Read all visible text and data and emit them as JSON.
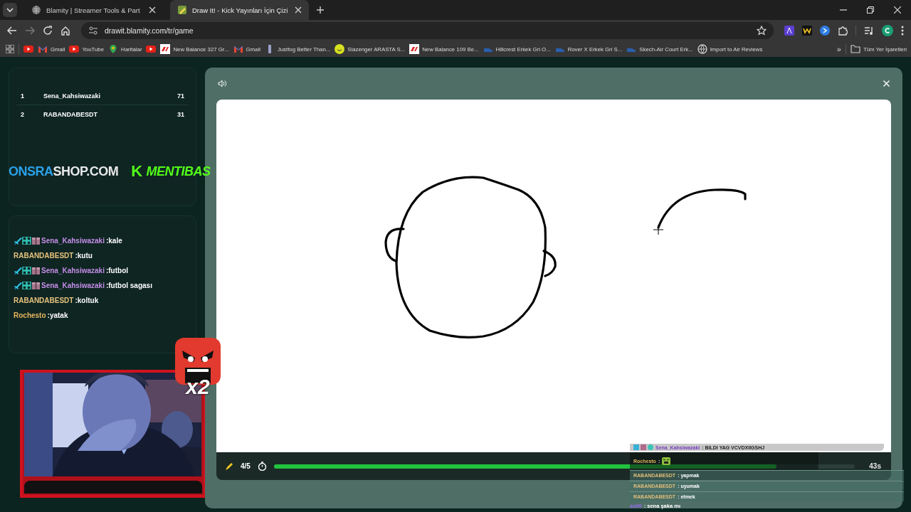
{
  "browser": {
    "tabs": [
      {
        "title": "Blamity | Streamer Tools & Part",
        "selected": false
      },
      {
        "title": "Draw It! - Kick Yayınları İçin Çizi",
        "selected": true
      }
    ],
    "url": "drawit.blamity.com/tr/game",
    "bookmarks": [
      {
        "kind": "icon"
      },
      {
        "kind": "link",
        "label": "Gmail"
      },
      {
        "kind": "link",
        "label": "YouTube"
      },
      {
        "kind": "link",
        "label": "Haritalar"
      },
      {
        "kind": "icon"
      },
      {
        "kind": "link",
        "label": "New Balance 327 Gr..."
      },
      {
        "kind": "link",
        "label": "Gmail"
      },
      {
        "kind": "link",
        "label": "Justfog Better Than..."
      },
      {
        "kind": "link",
        "label": "Slazenger ARASTA S..."
      },
      {
        "kind": "link",
        "label": "New Balance 109 Be..."
      },
      {
        "kind": "link",
        "label": "Hillcrest Erkek Gri O..."
      },
      {
        "kind": "link",
        "label": "Rover X Erkek Gri S..."
      },
      {
        "kind": "link",
        "label": "Skech-Air Court Erk..."
      },
      {
        "kind": "link",
        "label": "Import to Air Reviews"
      }
    ],
    "more": "»",
    "all_bookmarks": "Tüm Yer İşaretleri"
  },
  "leaderboard": [
    {
      "rank": "1",
      "name": "Sena_Kahsiwazaki",
      "score": "71"
    },
    {
      "rank": "2",
      "name": "RABANDABESDT",
      "score": "31"
    }
  ],
  "overlay_logos": {
    "shop_blue": "ONSRA",
    "shop_white": "SHOP.COM",
    "kick_mark": "K",
    "channel": "MENTIBAS"
  },
  "chat": [
    {
      "name": "Sena_Kahsiwazaki",
      "message": ":kale",
      "badges": true,
      "color": "#c58ee8"
    },
    {
      "name": "RABANDABESDT",
      "message": ":kutu",
      "badges": false,
      "color": "#e6c27c"
    },
    {
      "name": "Sena_Kahsiwazaki",
      "message": ":futbol",
      "badges": true,
      "color": "#c58ee8"
    },
    {
      "name": "Sena_Kahsiwazaki",
      "message": ":futbol sagası",
      "badges": true,
      "color": "#c58ee8"
    },
    {
      "name": "RABANDABESDT",
      "message": ":koltuk",
      "badges": false,
      "color": "#e6c27c"
    },
    {
      "name": "Rochesto",
      "message": ":yatak",
      "badges": false,
      "color": "#e8b65e"
    }
  ],
  "emote": {
    "multiplier": "x2"
  },
  "game": {
    "round": "4/5",
    "timer": "43s",
    "level": 0.865
  },
  "stream_chat": [
    {
      "kind": "highlight",
      "name": "Sena_Kahsiwazaki",
      "message": ": BILDI YAG VCVDXIIGSHJ",
      "color": "#7a3fc0"
    },
    {
      "kind": "emote",
      "name": "Rochesto",
      "message": ":",
      "color": "#d9b45a"
    },
    {
      "kind": "text",
      "name": "RABANDABESDT",
      "message": ": yapmak",
      "color": "#e0bd7a"
    },
    {
      "kind": "text",
      "name": "RABANDABESDT",
      "message": ": uyumak",
      "color": "#e0bd7a"
    },
    {
      "kind": "text",
      "name": "RABANDABESDT",
      "message": ": etmek",
      "color": "#e0bd7a"
    },
    {
      "kind": "plain",
      "name": "se00",
      "message": ": sena şaka mı",
      "color": "#9a6cf0"
    }
  ]
}
